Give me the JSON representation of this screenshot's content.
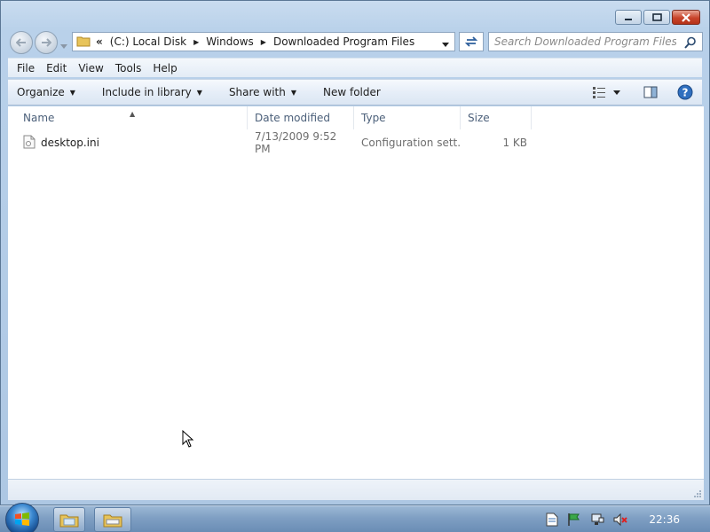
{
  "window": {
    "controls": {
      "minimize": "minimize-icon",
      "maximize": "maximize-icon",
      "close": "close-icon"
    }
  },
  "address": {
    "overflow": "«",
    "breadcrumbs": [
      "(C:) Local Disk",
      "Windows",
      "Downloaded Program Files"
    ]
  },
  "search": {
    "placeholder": "Search Downloaded Program Files"
  },
  "menu": {
    "items": [
      {
        "label": "File"
      },
      {
        "label": "Edit"
      },
      {
        "label": "View"
      },
      {
        "label": "Tools"
      },
      {
        "label": "Help"
      }
    ]
  },
  "commands": {
    "organize": "Organize",
    "include": "Include in library",
    "share": "Share with",
    "new_folder": "New folder"
  },
  "columns": {
    "name": "Name",
    "date": "Date modified",
    "type": "Type",
    "size": "Size"
  },
  "files": [
    {
      "name": "desktop.ini",
      "date": "7/13/2009 9:52 PM",
      "type": "Configuration sett...",
      "size": "1 KB"
    }
  ],
  "taskbar": {
    "clock": "22:36"
  },
  "colors": {
    "frame": "#b9d1ea",
    "close": "#c8442b",
    "taskbar": "#7f9fc3"
  }
}
